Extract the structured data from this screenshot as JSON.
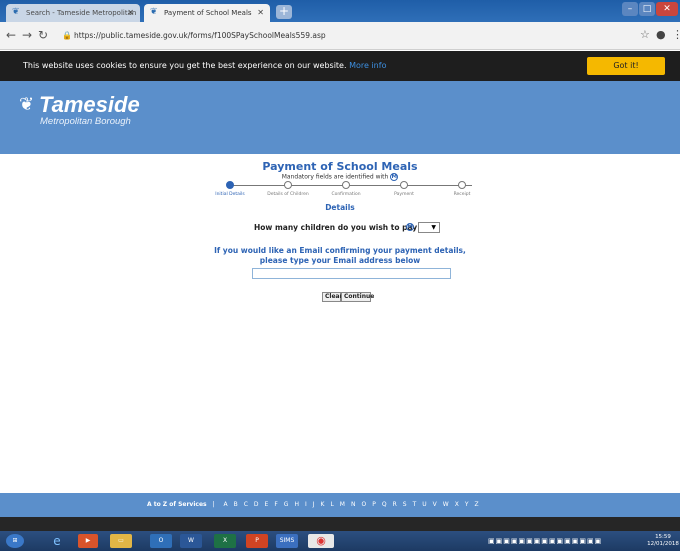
{
  "browser": {
    "tabs": [
      {
        "label": "Search - Tameside Metropolitan ..."
      },
      {
        "label": "Payment of School Meals"
      }
    ],
    "url": "https://public.tameside.gov.uk/forms/f100SPaySchoolMeals559.asp"
  },
  "cookie_bar": {
    "text": "This website uses cookies to ensure you get the best experience on our website.",
    "link": "More info",
    "button": "Got it!"
  },
  "header": {
    "logo_name": "Tameside",
    "logo_sub": "Metropolitan Borough"
  },
  "form": {
    "title": "Payment of School Meals",
    "mandatory_note": "Mandatory fields are identified with",
    "mandatory_mark": "M",
    "steps": [
      {
        "label": "Initial Details"
      },
      {
        "label": "Details of Children"
      },
      {
        "label": "Confirmation"
      },
      {
        "label": "Payment"
      },
      {
        "label": "Receipt"
      }
    ],
    "current_step": 0,
    "section_title": "Details",
    "question": "How many children do you wish to pay for?",
    "question_select_value": "",
    "email_prompt_line1": "If you would like an Email confirming your payment details,",
    "email_prompt_line2": "please type your Email address below",
    "email_value": "",
    "clear_button": "Clear",
    "continue_button": "Continue"
  },
  "footer": {
    "az_label": "A to Z of Services",
    "letters": [
      "A",
      "B",
      "C",
      "D",
      "E",
      "F",
      "G",
      "H",
      "I",
      "J",
      "K",
      "L",
      "M",
      "N",
      "O",
      "P",
      "Q",
      "R",
      "S",
      "T",
      "U",
      "V",
      "W",
      "X",
      "Y",
      "Z"
    ]
  },
  "taskbar": {
    "sims_label": "SIMS",
    "time": "15:59",
    "date": "12/01/2018"
  },
  "colors": {
    "brand_blue": "#5b8fcb",
    "form_blue": "#2d63b4",
    "cookie_button": "#f5b800"
  }
}
